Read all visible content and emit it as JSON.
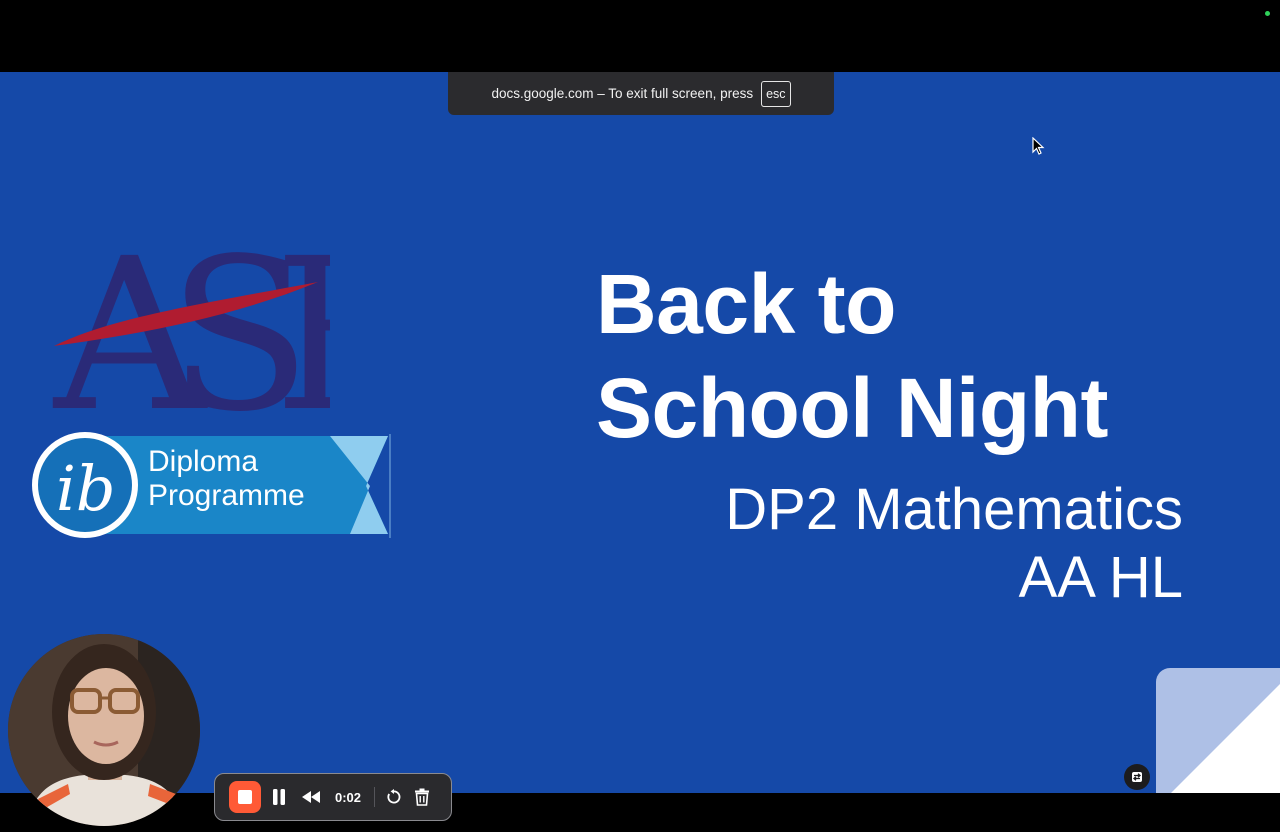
{
  "browser": {
    "fullscreen_notice": "docs.google.com – To exit full screen, press",
    "esc_key": "esc"
  },
  "slide": {
    "logos": {
      "asb_text": "ASB",
      "ib_line1": "Diploma",
      "ib_line2": "Programme"
    },
    "title_line1": "Back to",
    "title_line2": "School Night",
    "subtitle_line1": "DP2 Mathematics",
    "subtitle_line2": "AA HL",
    "background_color": "#1549a8"
  },
  "recorder": {
    "timer": "0:02",
    "accent_color": "#ff5a36",
    "controls": [
      "stop-icon",
      "pause-icon",
      "rewind-icon",
      "restart-icon",
      "trash-icon"
    ]
  },
  "webcam": {
    "label": "webcam-preview"
  },
  "status": {
    "indicator_color": "#2fd15a"
  }
}
